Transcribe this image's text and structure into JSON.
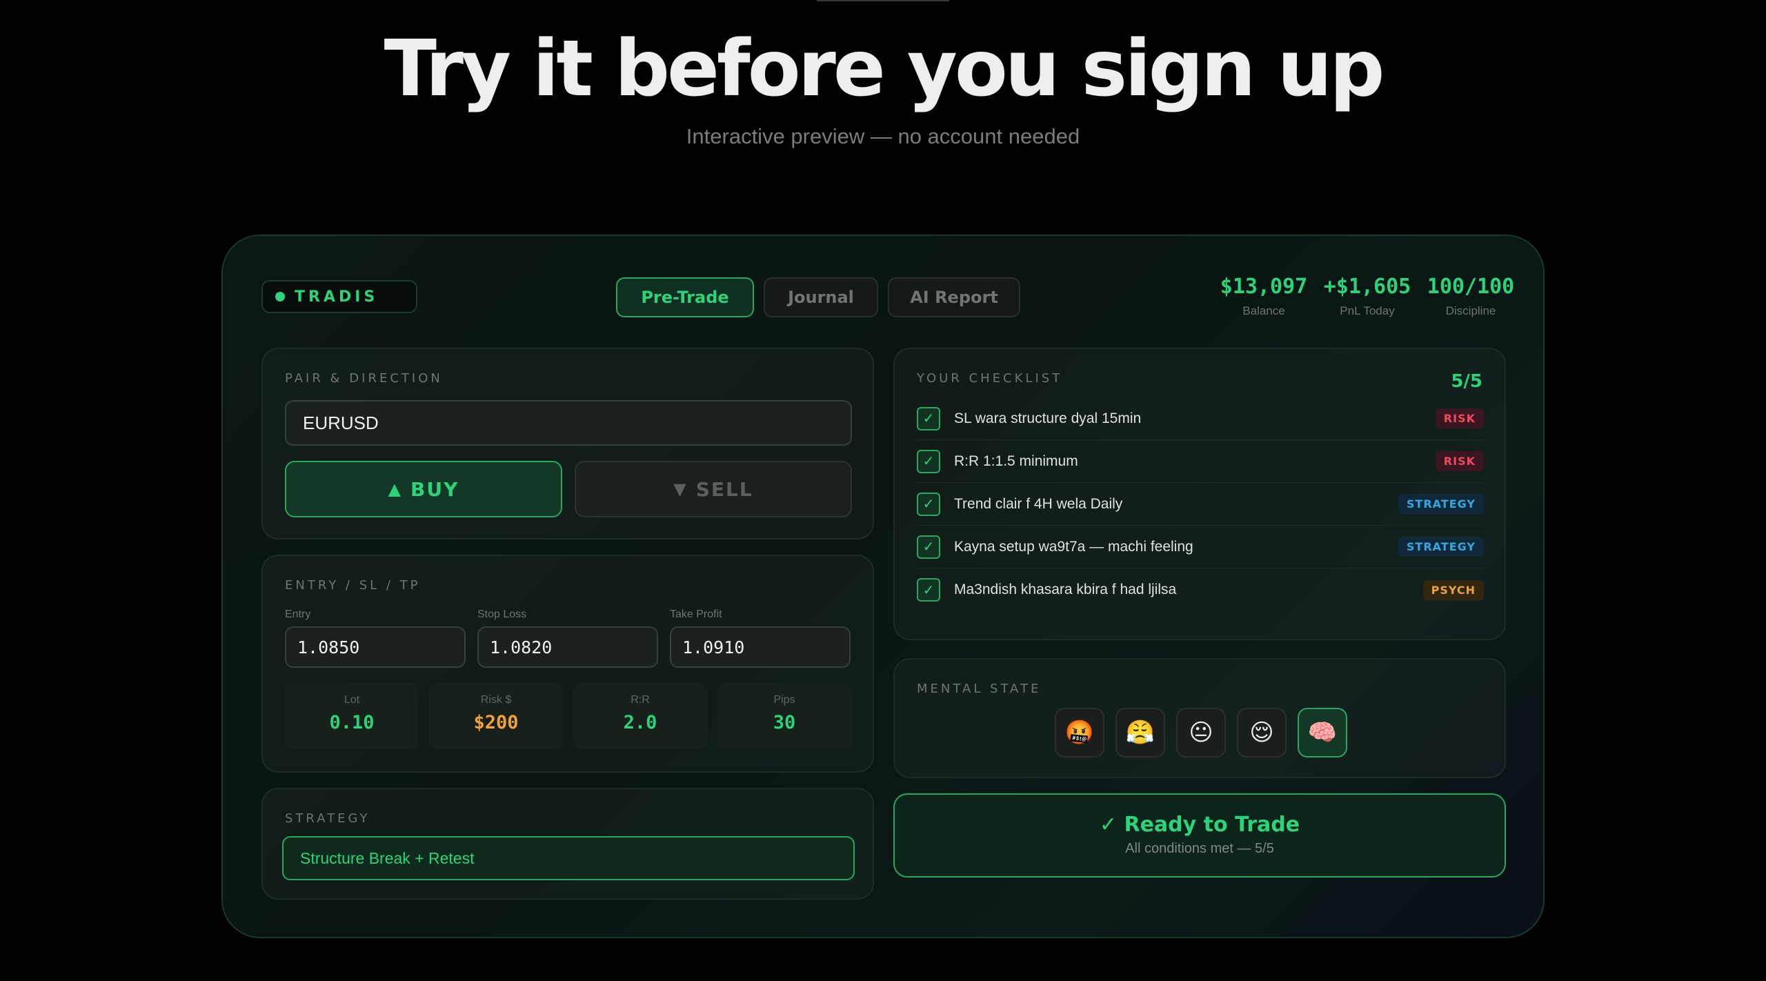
{
  "hero": {
    "title": "Try it before you sign up",
    "subtitle": "Interactive preview — no account needed"
  },
  "app": {
    "brand": "TRADIS",
    "tabs": [
      {
        "label": "Pre-Trade",
        "active": true
      },
      {
        "label": "Journal",
        "active": false
      },
      {
        "label": "AI Report",
        "active": false
      }
    ],
    "stats": [
      {
        "value": "$13,097",
        "label": "Balance"
      },
      {
        "value": "+$1,605",
        "label": "PnL Today"
      },
      {
        "value": "100/100",
        "label": "Discipline"
      }
    ]
  },
  "pair": {
    "title": "PAIR & DIRECTION",
    "value": "EURUSD",
    "buy_arrow": "▲",
    "buy_label": "BUY",
    "sell_arrow": "▼",
    "sell_label": "SELL"
  },
  "levels": {
    "title": "ENTRY / SL / TP",
    "entry_label": "Entry",
    "entry": "1.0850",
    "sl_label": "Stop Loss",
    "sl": "1.0820",
    "tp_label": "Take Profit",
    "tp": "1.0910",
    "metrics": [
      {
        "label": "Lot",
        "value": "0.10",
        "color": "#2bd37a"
      },
      {
        "label": "Risk $",
        "value": "$200",
        "color": "#f0a23a"
      },
      {
        "label": "R:R",
        "value": "2.0",
        "color": "#2bd37a"
      },
      {
        "label": "Pips",
        "value": "30",
        "color": "#2bd37a"
      }
    ]
  },
  "strategy": {
    "title": "STRATEGY",
    "value": "Structure Break + Retest"
  },
  "checklist": {
    "title": "YOUR CHECKLIST",
    "count": "5/5",
    "check_mark": "✓",
    "items": [
      {
        "text": "SL wara structure dyal 15min",
        "tag": "RISK"
      },
      {
        "text": "R:R 1:1.5 minimum",
        "tag": "RISK"
      },
      {
        "text": "Trend clair f 4H wela Daily",
        "tag": "STRATEGY"
      },
      {
        "text": "Kayna setup wa9t7a — machi feeling",
        "tag": "STRATEGY"
      },
      {
        "text": "Ma3ndish khasara kbira f had ljilsa",
        "tag": "PSYCH"
      }
    ]
  },
  "mental": {
    "title": "MENTAL STATE",
    "states": [
      {
        "glyph": "🤬",
        "icon": "cursing-face-icon",
        "selected": false
      },
      {
        "glyph": "😤",
        "icon": "frustrated-face-icon",
        "selected": false
      },
      {
        "glyph": "😐",
        "icon": "neutral-face-icon",
        "selected": false
      },
      {
        "glyph": "😌",
        "icon": "relieved-face-icon",
        "selected": false
      },
      {
        "glyph": "🧠",
        "icon": "brain-icon",
        "selected": true
      }
    ]
  },
  "ready": {
    "title": "✓ Ready to Trade",
    "subtitle": "All conditions met — 5/5"
  },
  "colors": {
    "accent": "#2bd37a",
    "risk": "#ef4a62",
    "strategy": "#35a8e0",
    "psych": "#e8a33a",
    "warning": "#f0a23a"
  }
}
